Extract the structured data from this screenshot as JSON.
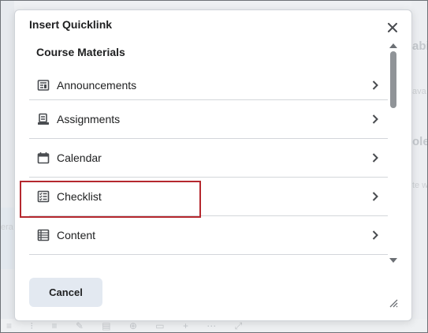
{
  "dialog": {
    "title": "Insert Quicklink",
    "section_title": "Course Materials",
    "items": [
      {
        "label": "Announcements",
        "icon": "announcements-icon"
      },
      {
        "label": "Assignments",
        "icon": "assignments-icon"
      },
      {
        "label": "Calendar",
        "icon": "calendar-icon"
      },
      {
        "label": "Checklist",
        "icon": "checklist-icon"
      },
      {
        "label": "Content",
        "icon": "content-icon"
      }
    ],
    "cancel_label": "Cancel"
  },
  "background": {
    "right_heading_1": "abi",
    "right_small_1": "ava",
    "right_heading_2": "ole",
    "right_small_2": "te w",
    "left_small": "era"
  },
  "colors": {
    "highlight": "#b5282e",
    "cancel_bg": "#e3e9f1",
    "text": "#202122",
    "divider": "#d3d6da"
  }
}
